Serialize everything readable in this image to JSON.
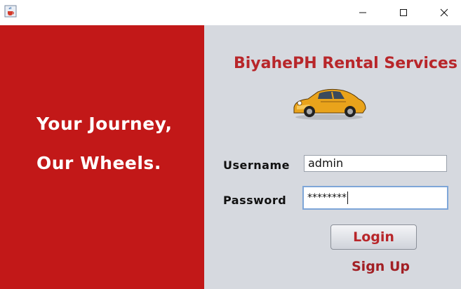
{
  "window": {
    "minimize_icon": "minimize-icon",
    "maximize_icon": "maximize-icon",
    "close_icon": "close-icon",
    "app_icon": "java-cup-icon"
  },
  "left_panel": {
    "tagline_line1": "Your Journey,",
    "tagline_line2": "Our Wheels.",
    "background": "#c21818"
  },
  "right_panel": {
    "brand_title": "BiyahePH Rental Services",
    "logo_icon": "car-icon"
  },
  "form": {
    "username_label": "Username",
    "username_value": "admin",
    "password_label": "Password",
    "password_masked": "********",
    "login_label": "Login",
    "signup_label": "Sign Up"
  },
  "colors": {
    "brand_red": "#b8262a",
    "panel_gray": "#d6d9df"
  }
}
